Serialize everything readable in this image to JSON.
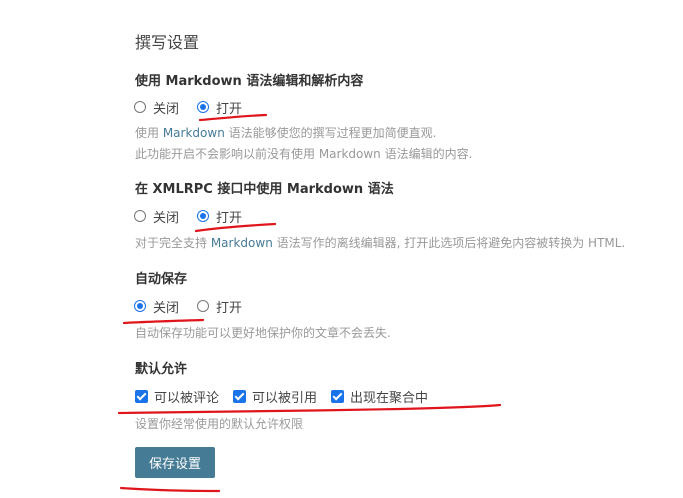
{
  "page_title": "撰写设置",
  "markdown": {
    "title": "使用 Markdown 语法编辑和解析内容",
    "options": [
      "关闭",
      "打开"
    ],
    "selected": "打开",
    "desc_line1_pre": "使用 ",
    "desc_line1_link": "Markdown",
    "desc_line1_post": " 语法能够使您的撰写过程更加简便直观.",
    "desc_line2": "此功能开启不会影响以前没有使用 Markdown 语法编辑的内容."
  },
  "xmlrpc": {
    "title": "在 XMLRPC 接口中使用 Markdown 语法",
    "options": [
      "关闭",
      "打开"
    ],
    "selected": "打开",
    "desc_pre": "对于完全支持 ",
    "desc_link": "Markdown",
    "desc_post": " 语法写作的离线编辑器, 打开此选项后将避免内容被转换为 HTML."
  },
  "autosave": {
    "title": "自动保存",
    "options": [
      "关闭",
      "打开"
    ],
    "selected": "关闭",
    "desc": "自动保存功能可以更好地保护你的文章不会丢失."
  },
  "default_allow": {
    "title": "默认允许",
    "checkboxes": [
      "可以被评论",
      "可以被引用",
      "出现在聚合中"
    ],
    "checked": [
      true,
      true,
      true
    ],
    "desc": "设置你经常使用的默认允许权限"
  },
  "save_button": "保存设置",
  "colors": {
    "accent": "#1a73e8",
    "button": "#467b96",
    "annotation": "#e0151c"
  }
}
